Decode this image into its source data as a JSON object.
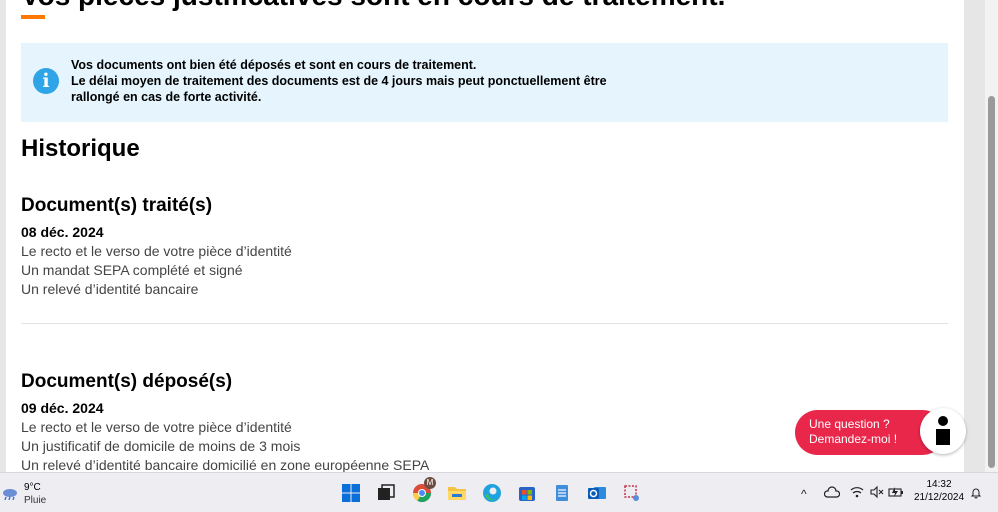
{
  "page": {
    "title": "Vos pièces justificatives sont en cours de traitement.",
    "info": {
      "line1": "Vos documents ont bien été déposés et sont en cours de traitement.",
      "line2": "Le délai moyen de traitement des documents est de 4 jours mais peut ponctuellement être",
      "line3": "rallongé en cas de forte activité."
    },
    "history_title": "Historique",
    "processed": {
      "title": "Document(s) traité(s)",
      "date": "08 déc. 2024",
      "items": [
        "Le recto et le verso de votre pièce d’identité",
        "Un mandat SEPA complété et signé",
        "Un relevé d’identité bancaire"
      ]
    },
    "deposited": {
      "title": "Document(s) déposé(s)",
      "date": "09 déc. 2024",
      "items": [
        "Le recto et le verso de votre pièce d’identité",
        "Un justificatif de domicile de moins de 3 mois",
        "Un relevé d’identité bancaire domicilié en zone européenne SEPA"
      ]
    }
  },
  "chat": {
    "line1": "Une question ?",
    "line2": "Demandez-moi !"
  },
  "taskbar": {
    "weather_temp": "9°C",
    "weather_cond": "Pluie",
    "chrome_badge": "M",
    "time": "14:32",
    "date": "21/12/2024",
    "tray_chevron": "^"
  },
  "colors": {
    "accent_orange": "#ff7900",
    "info_bg": "#e6f5fd",
    "info_icon": "#2fa4e7",
    "chat_red": "#e8274b"
  }
}
